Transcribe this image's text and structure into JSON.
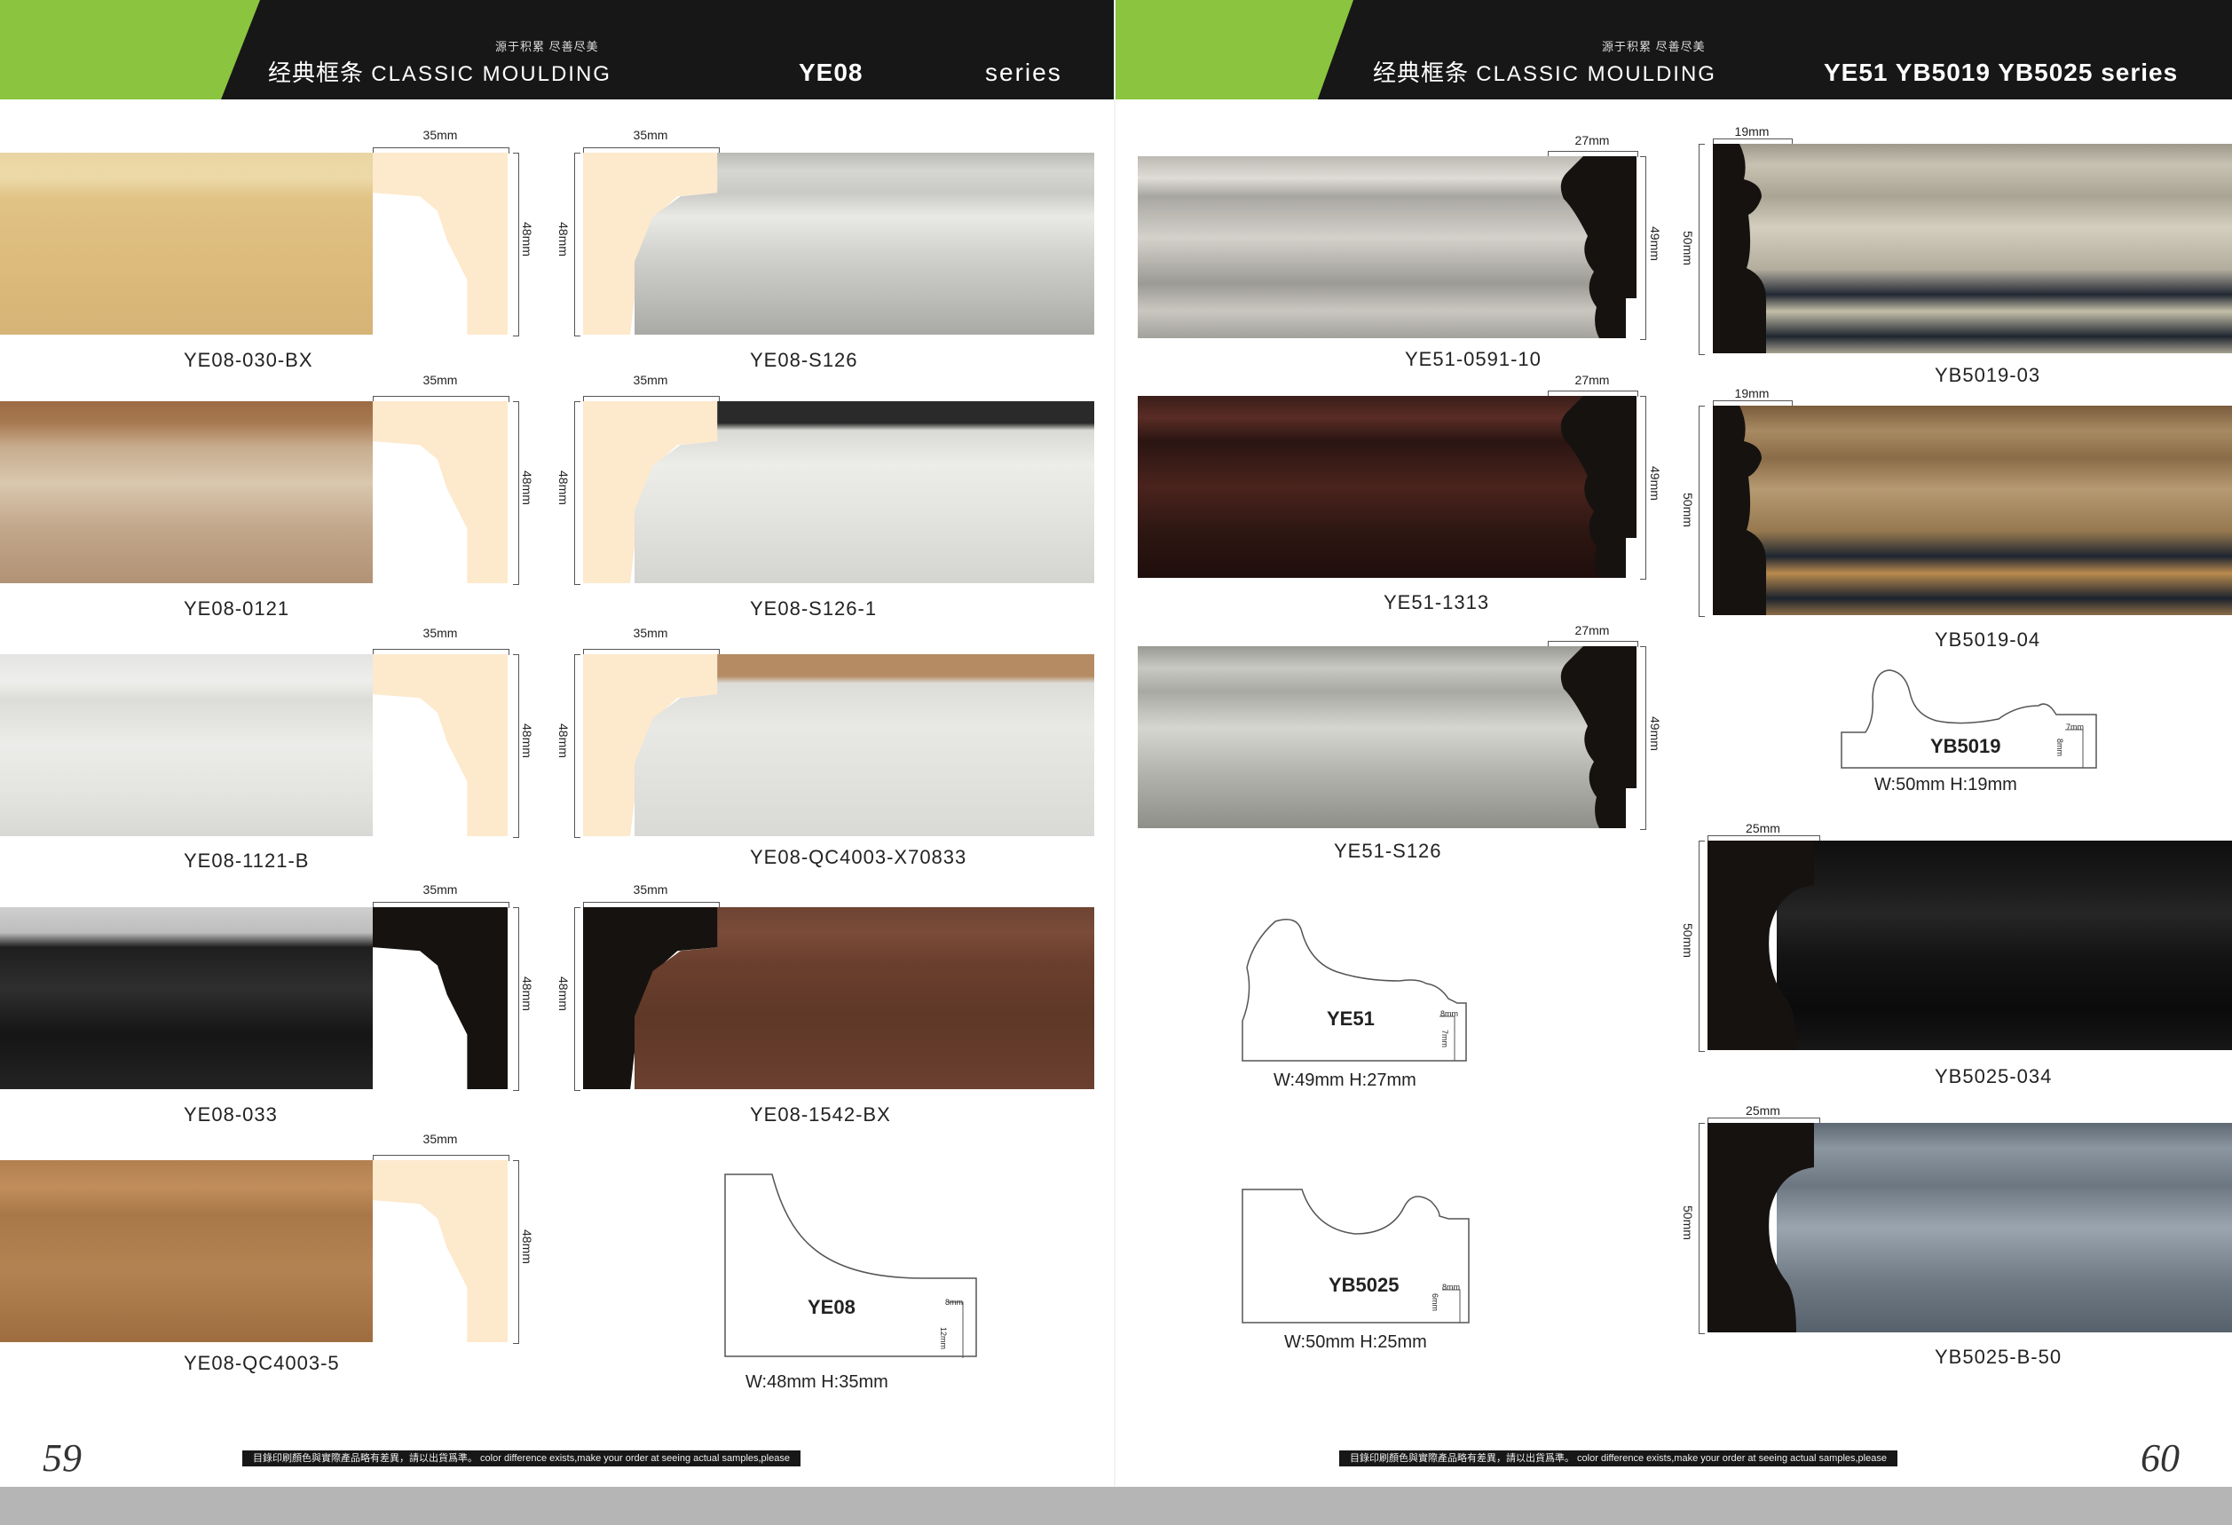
{
  "left": {
    "header": {
      "slogan": "源于积累 尽善尽美",
      "title_cn": "经典框条",
      "title_en": "CLASSIC MOULDING",
      "series_code": "YE08",
      "series_word": "series"
    },
    "products": [
      {
        "code": "YE08-030-BX",
        "width": "35mm",
        "height": "48mm"
      },
      {
        "code": "YE08-S126",
        "width": "35mm",
        "height": "48mm"
      },
      {
        "code": "YE08-0121",
        "width": "35mm",
        "height": "48mm"
      },
      {
        "code": "YE08-S126-1",
        "width": "35mm",
        "height": "48mm"
      },
      {
        "code": "YE08-1121-B",
        "width": "35mm",
        "height": "48mm"
      },
      {
        "code": "YE08-QC4003-X70833",
        "width": "35mm",
        "height": "48mm"
      },
      {
        "code": "YE08-033",
        "width": "35mm",
        "height": "48mm"
      },
      {
        "code": "YE08-1542-BX",
        "width": "35mm",
        "height": "48mm"
      },
      {
        "code": "YE08-QC4003-5",
        "width": "35mm",
        "height": "48mm"
      }
    ],
    "profile": {
      "name": "YE08",
      "dims": "W:48mm  H:35mm",
      "t1": "8mm",
      "t2": "12mm"
    },
    "page_number": "59",
    "note": "目錄印刷顏色與實際產品略有差異，請以出貨爲準。 color difference exists,make your order at seeing actual samples,please"
  },
  "right": {
    "header": {
      "slogan": "源于积累 尽善尽美",
      "title_cn": "经典框条",
      "title_en": "CLASSIC MOULDING",
      "series_code": "YE51 YB5019 YB5025 series"
    },
    "products": [
      {
        "code": "YE51-0591-10",
        "width": "27mm",
        "height": "49mm"
      },
      {
        "code": "YE51-1313",
        "width": "27mm",
        "height": "49mm"
      },
      {
        "code": "YE51-S126",
        "width": "27mm",
        "height": "49mm"
      },
      {
        "code": "YB5019-03",
        "width": "19mm",
        "height": "50mm"
      },
      {
        "code": "YB5019-04",
        "width": "19mm",
        "height": "50mm"
      },
      {
        "code": "YB5025-034",
        "width": "25mm",
        "height": "50mm"
      },
      {
        "code": "YB5025-B-50",
        "width": "25mm",
        "height": "50mm"
      }
    ],
    "profiles": [
      {
        "name": "YE51",
        "dims": "W:49mm  H:27mm",
        "t1": "8mm",
        "t2": "7mm"
      },
      {
        "name": "YB5025",
        "dims": "W:50mm  H:25mm",
        "t1": "8mm",
        "t2": "6mm"
      },
      {
        "name": "YB5019",
        "dims": "W:50mm  H:19mm",
        "t1": "7mm",
        "t2": "8mm"
      }
    ],
    "page_number": "60",
    "note": "目錄印刷顏色與實際產品略有差異，請以出貨爲準。 color difference exists,make your order at seeing actual samples,please"
  },
  "colors": {
    "header_bg": "#171717",
    "accent_green": "#8bc43f",
    "section_cream": "#fde9cc",
    "section_black": "#161210"
  }
}
